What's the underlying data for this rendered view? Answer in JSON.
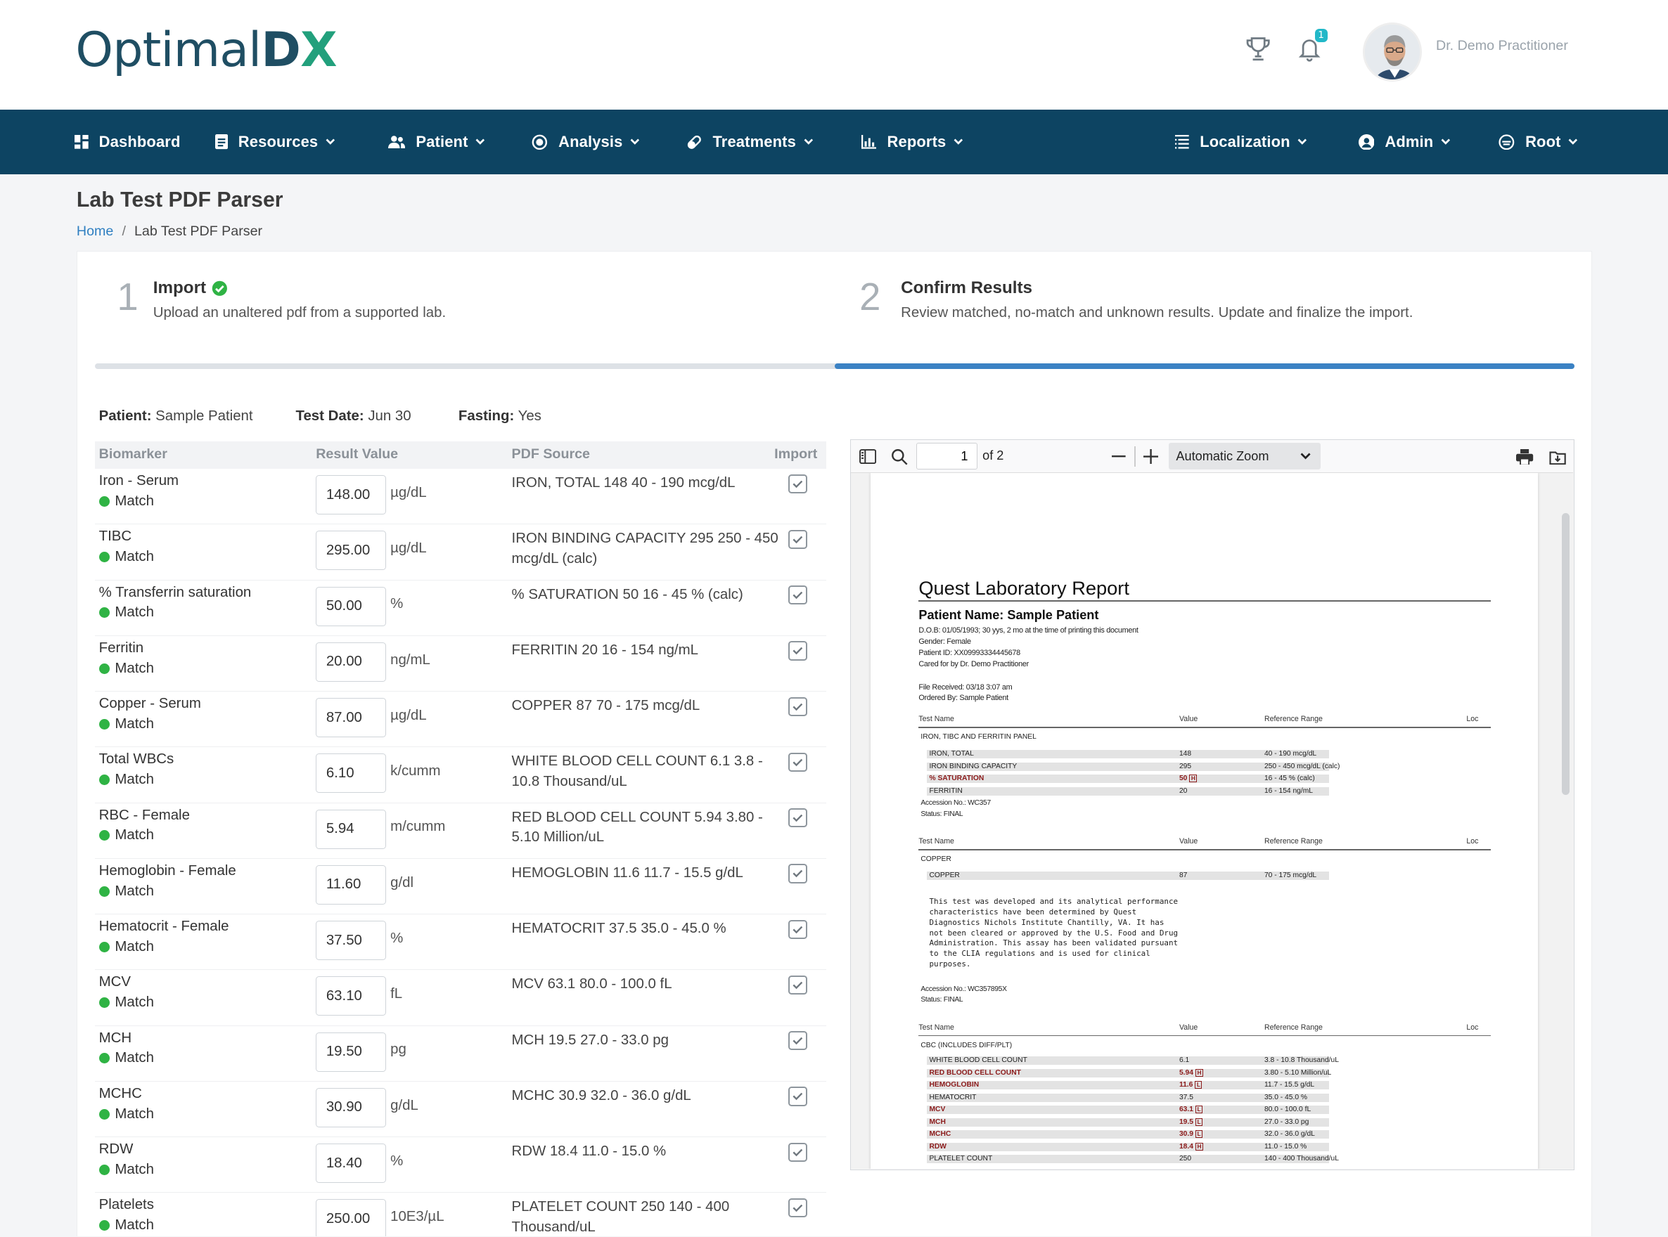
{
  "header": {
    "logo": {
      "main": "Optimal",
      "bold_a": "D",
      "bold_b": "X"
    },
    "notification_count": "1",
    "user_name": "Dr. Demo Practitioner"
  },
  "nav": {
    "items": [
      {
        "label": "Dashboard",
        "icon": "dashboard-icon"
      },
      {
        "label": "Resources",
        "icon": "document-icon"
      },
      {
        "label": "Patient",
        "icon": "users-icon"
      },
      {
        "label": "Analysis",
        "icon": "target-icon"
      },
      {
        "label": "Treatments",
        "icon": "pill-icon"
      },
      {
        "label": "Reports",
        "icon": "bar-chart-icon"
      },
      {
        "label": "Localization",
        "icon": "list-icon"
      },
      {
        "label": "Admin",
        "icon": "user-circle-icon"
      },
      {
        "label": "Root",
        "icon": "mask-icon"
      }
    ]
  },
  "page": {
    "title": "Lab Test PDF Parser",
    "breadcrumb": {
      "home": "Home",
      "current": "Lab Test PDF Parser"
    }
  },
  "steps": [
    {
      "number": "1",
      "title": "Import",
      "description": "Upload an unaltered pdf from a supported lab.",
      "complete": true
    },
    {
      "number": "2",
      "title": "Confirm Results",
      "description": "Review matched, no-match and unknown results. Update and finalize the import."
    }
  ],
  "progress_percent": 50,
  "meta": {
    "patient_label": "Patient:",
    "patient": "Sample Patient",
    "date_label": "Test Date:",
    "date": "Jun 30",
    "fasting_label": "Fasting:",
    "fasting": "Yes"
  },
  "table": {
    "headers": {
      "biomarker": "Biomarker",
      "value": "Result Value",
      "source": "PDF Source",
      "import": "Import"
    },
    "rows": [
      {
        "name": "Iron - Serum",
        "status": "Match",
        "value": "148.00",
        "unit": "µg/dL",
        "source": "IRON, TOTAL 148 40 - 190 mcg/dL"
      },
      {
        "name": "TIBC",
        "status": "Match",
        "value": "295.00",
        "unit": "µg/dL",
        "source": "IRON BINDING CAPACITY 295 250 - 450 mcg/dL (calc)"
      },
      {
        "name": "% Transferrin saturation",
        "status": "Match",
        "value": "50.00",
        "unit": "%",
        "source": "% SATURATION 50 16 - 45 % (calc)"
      },
      {
        "name": "Ferritin",
        "status": "Match",
        "value": "20.00",
        "unit": "ng/mL",
        "source": "FERRITIN 20 16 - 154 ng/mL"
      },
      {
        "name": "Copper - Serum",
        "status": "Match",
        "value": "87.00",
        "unit": "µg/dL",
        "source": "COPPER 87 70 - 175 mcg/dL"
      },
      {
        "name": "Total WBCs",
        "status": "Match",
        "value": "6.10",
        "unit": "k/cumm",
        "source": "WHITE BLOOD CELL COUNT 6.1 3.8 - 10.8 Thousand/uL"
      },
      {
        "name": "RBC - Female",
        "status": "Match",
        "value": "5.94",
        "unit": "m/cumm",
        "source": "RED BLOOD CELL COUNT 5.94 3.80 - 5.10 Million/uL"
      },
      {
        "name": "Hemoglobin - Female",
        "status": "Match",
        "value": "11.60",
        "unit": "g/dl",
        "source": "HEMOGLOBIN 11.6 11.7 - 15.5 g/dL"
      },
      {
        "name": "Hematocrit - Female",
        "status": "Match",
        "value": "37.50",
        "unit": "%",
        "source": "HEMATOCRIT 37.5 35.0 - 45.0 %"
      },
      {
        "name": "MCV",
        "status": "Match",
        "value": "63.10",
        "unit": "fL",
        "source": "MCV 63.1 80.0 - 100.0 fL"
      },
      {
        "name": "MCH",
        "status": "Match",
        "value": "19.50",
        "unit": "pg",
        "source": "MCH 19.5 27.0 - 33.0 pg"
      },
      {
        "name": "MCHC",
        "status": "Match",
        "value": "30.90",
        "unit": "g/dL",
        "source": "MCHC 30.9 32.0 - 36.0 g/dL"
      },
      {
        "name": "RDW",
        "status": "Match",
        "value": "18.40",
        "unit": "%",
        "source": "RDW 18.4 11.0 - 15.0 %"
      },
      {
        "name": "Platelets",
        "status": "Match",
        "value": "250.00",
        "unit": "10E3/µL",
        "source": "PLATELET COUNT 250 140 - 400 Thousand/uL"
      }
    ]
  },
  "pdf_viewer": {
    "page": "1",
    "of_pages": "of 2",
    "zoom": "Automatic Zoom",
    "report": {
      "title": "Quest Laboratory Report",
      "patient_name": "Patient Name: Sample Patient",
      "dob": "D.O.B: 01/05/1993; 30 yys, 2 mo at the time of printing this document",
      "gender": "Gender: Female",
      "patient_id": "Patient ID: XX09993334445678",
      "cared_for": "Cared for by Dr. Demo Practitioner",
      "file_received": "File Received: 03/18 3:07 am",
      "ordered_by": "Ordered By: Sample Patient",
      "col_test": "Test Name",
      "col_value": "Value",
      "col_range": "Reference Range",
      "col_loc": "Loc",
      "panel1": "IRON, TIBC AND FERRITIN PANEL",
      "panel1_rows": [
        {
          "name": "IRON, TOTAL",
          "value": "148",
          "range": "40 - 190 mcg/dL"
        },
        {
          "name": "IRON BINDING CAPACITY",
          "value": "295",
          "range": "250 - 450 mcg/dL (calc)"
        },
        {
          "name": "% SATURATION",
          "value": "50",
          "flag": "H",
          "range": "16 - 45 % (calc)"
        },
        {
          "name": "FERRITIN",
          "value": "20",
          "range": "16 - 154 ng/mL"
        }
      ],
      "accession1": "Accession No.: WC357",
      "status1": "Status: FINAL",
      "panel2": "COPPER",
      "panel2_rows": [
        {
          "name": "COPPER",
          "value": "87",
          "range": "70 - 175 mcg/dL"
        }
      ],
      "disclaimer": "This test was developed and its analytical performance\ncharacteristics have been determined by Quest\nDiagnostics Nichols Institute Chantilly, VA. It has\nnot been cleared or approved by the U.S. Food and Drug\nAdministration. This assay has been validated pursuant\nto the CLIA regulations and is used for clinical\npurposes.",
      "accession2": "Accession No.: WC357895X",
      "status2": "Status: FINAL",
      "panel3": "CBC (INCLUDES DIFF/PLT)",
      "panel3_rows": [
        {
          "name": "WHITE BLOOD CELL COUNT",
          "value": "6.1",
          "range": "3.8 - 10.8 Thousand/uL"
        },
        {
          "name": "RED BLOOD CELL COUNT",
          "value": "5.94",
          "flag": "H",
          "range": "3.80 - 5.10 Million/uL"
        },
        {
          "name": "HEMOGLOBIN",
          "value": "11.6",
          "flag": "L",
          "range": "11.7 - 15.5 g/dL"
        },
        {
          "name": "HEMATOCRIT",
          "value": "37.5",
          "range": "35.0 - 45.0 %"
        },
        {
          "name": "MCV",
          "value": "63.1",
          "flag": "L",
          "range": "80.0 - 100.0 fL"
        },
        {
          "name": "MCH",
          "value": "19.5",
          "flag": "L",
          "range": "27.0 - 33.0 pg"
        },
        {
          "name": "MCHC",
          "value": "30.9",
          "flag": "L",
          "range": "32.0 - 36.0 g/dL"
        },
        {
          "name": "RDW",
          "value": "18.4",
          "flag": "H",
          "range": "11.0 - 15.0 %"
        },
        {
          "name": "PLATELET COUNT",
          "value": "250",
          "range": "140 - 400 Thousand/uL"
        }
      ]
    }
  },
  "colors": {
    "navbar": "#0d4462",
    "accent": "#3b82c4",
    "match": "#2fb344",
    "logo": "#1f4e63",
    "logo_x": "#22a07c"
  }
}
